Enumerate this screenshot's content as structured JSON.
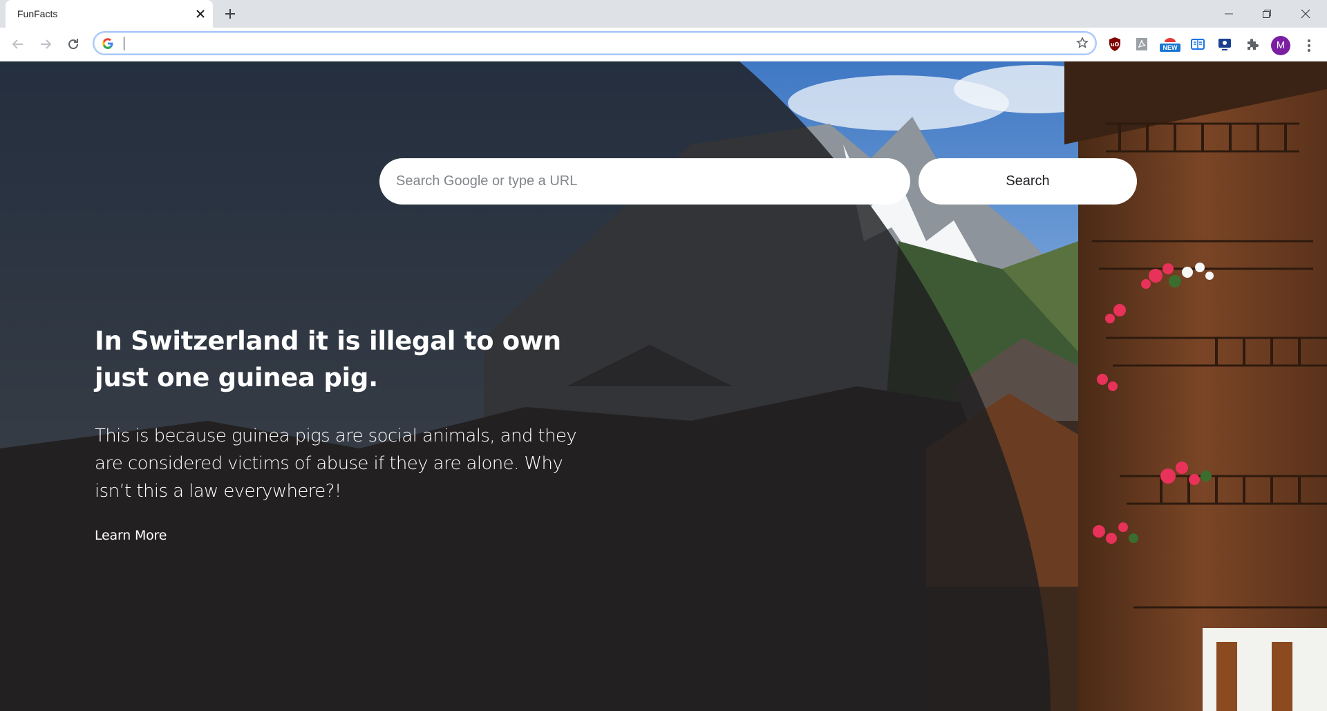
{
  "browser": {
    "tab_title": "FunFacts",
    "omnibox_value": "",
    "extensions": [
      "ublock-origin-icon",
      "pdf-icon",
      "new-badge-extension-icon",
      "reader-icon",
      "screen-cast-icon",
      "puzzle-extensions-icon"
    ],
    "new_badge": "NEW",
    "profile_initial": "M"
  },
  "search": {
    "placeholder": "Search Google or type a URL",
    "button_label": "Search"
  },
  "fact": {
    "title": "In Switzerland it is illegal to own just one guinea pig.",
    "body": "This is because guinea pigs are social animals, and they are considered victims of abuse if they are alone. Why isn’t this a law everywhere?!",
    "link_label": "Learn More"
  },
  "colors": {
    "sky": "#6f9fd6",
    "overlay": "#1e1f21",
    "wood": "#6b3f24",
    "flowers": "#e8325a",
    "avatar": "#7b1fa2"
  }
}
